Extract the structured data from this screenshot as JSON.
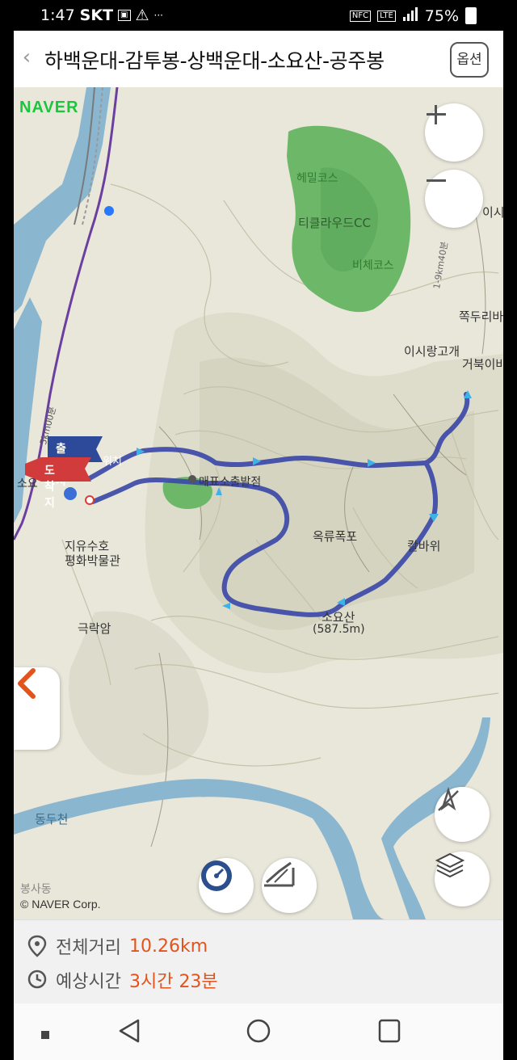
{
  "status_bar": {
    "time": "1:47",
    "carrier": "SKT",
    "battery": "75%",
    "nfc": "NFC",
    "lte": "LTE"
  },
  "header": {
    "back_icon": "chevron-left-icon",
    "title": "하백운대-감투봉-상백운대-소요산-공주봉",
    "options_label": "옵션"
  },
  "map": {
    "logo": "NAVER",
    "copyright": "© NAVER Corp.",
    "labels": {
      "hemil": "헤밀코스",
      "ticlewood": "티클라우드CC",
      "biche": "비체코스",
      "isiranggogae": "이시랑고개",
      "geobuk": "거북이바",
      "jjokduri": "쪽두리바",
      "isi": "이시",
      "maepyo": "매표소출발점",
      "okryu": "옥류폭포",
      "jayusuho": "지유수호",
      "pyeonghwa": "평화박물관",
      "geukrak": "극락암",
      "soyosan": "소요산",
      "elevation": "(587.5m)",
      "kalbawi": "칼바위",
      "dongducheon": "동두천",
      "bongsa": "봉사동",
      "soyo": "소요",
      "road_label": "1-9km40분",
      "rail_label": "5km00분"
    },
    "markers": {
      "start": "출발지",
      "end": "도착지",
      "current": "위치"
    },
    "zoom_in_icon": "plus-icon",
    "zoom_out_icon": "minus-icon"
  },
  "map_controls": {
    "side_toggle_icon": "chevron-left-icon",
    "compass_icon": "compass-off-icon",
    "layers_icon": "layers-icon",
    "speed_icon": "speedometer-icon",
    "elevation_icon": "elevation-profile-icon"
  },
  "route_info": {
    "distance_label": "전체거리",
    "distance_value": "10.26km",
    "time_label": "예상시간",
    "time_value": "3시간 23분"
  },
  "nav_bar": {
    "recent_icon": "square-dot-icon",
    "back_icon": "triangle-back-icon",
    "home_icon": "circle-home-icon",
    "overview_icon": "square-overview-icon"
  },
  "colors": {
    "route": "#3d4aa8",
    "accent": "#e2541b",
    "park": "#6db868",
    "water": "#8ab6cf"
  }
}
